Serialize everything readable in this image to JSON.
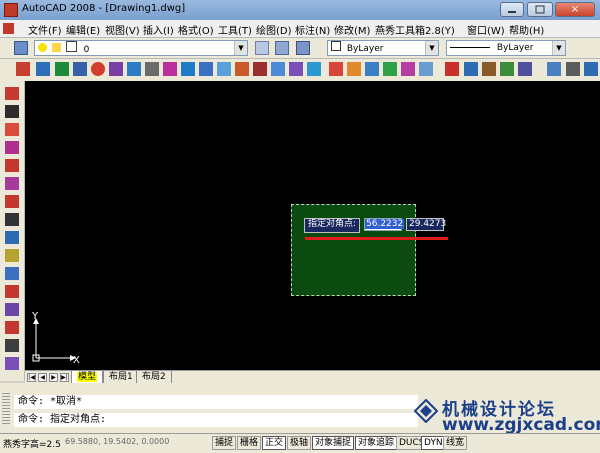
{
  "window": {
    "title": "AutoCAD 2008 - [Drawing1.dwg]",
    "close_label": "×"
  },
  "menu": [
    "文件(F)",
    "编辑(E)",
    "视图(V)",
    "插入(I)",
    "格式(O)",
    "工具(T)",
    "绘图(D)",
    "标注(N)",
    "修改(M)",
    "燕秀工具箱2.8(Y)",
    "窗口(W)",
    "帮助(H)"
  ],
  "layers": {
    "current_layer": "0",
    "color": "ByLayer",
    "linetype": "ByLayer"
  },
  "dynamic_input": {
    "prompt": "指定对角点:",
    "x_value": "56.2232",
    "y_value": "29.4273"
  },
  "ucs": {
    "x_label": "X",
    "y_label": "Y"
  },
  "tabs": {
    "model": "模型",
    "layout1": "布局1",
    "layout2": "布局2"
  },
  "command": {
    "line1": "命令: *取消*",
    "line2": "命令: 指定对角点:"
  },
  "watermark": {
    "brand": "机械设计论坛",
    "url": "www.zgjxcad.com"
  },
  "status": {
    "caption": "燕秀字高=2.5",
    "coords": "69.5880,  19.5402,  0.0000",
    "buttons": [
      "捕捉",
      "栅格",
      "正交",
      "极轴",
      "对象捕捉",
      "对象追踪",
      "DUCS",
      "DYN",
      "线宽"
    ]
  },
  "colors": {
    "canvas": "#000000",
    "selection_fill": "#0b4b10",
    "accent_red": "#e01c1c"
  }
}
